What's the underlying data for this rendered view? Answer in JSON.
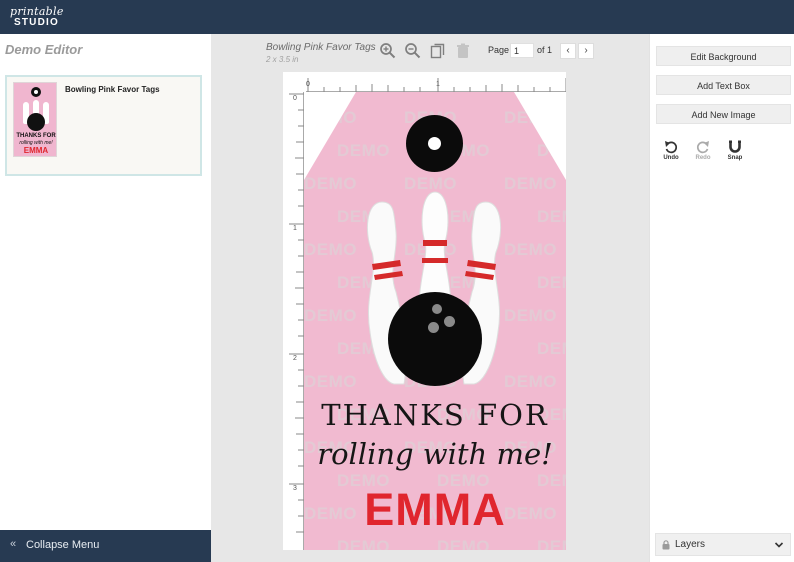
{
  "app": {
    "logo_line1": "printable",
    "logo_line2": "STUDIO"
  },
  "sidebar": {
    "title": "Demo Editor",
    "documents": [
      {
        "name": "Bowling Pink Favor Tags",
        "thumb_text_top": "THANKS FOR",
        "thumb_text_mid": "rolling with me!",
        "thumb_text_name": "EMMA"
      }
    ],
    "collapse_label": "Collapse Menu"
  },
  "toolbar": {
    "doc_title": "Bowling Pink Favor Tags",
    "doc_size": "2 x 3.5 in",
    "page_label": "Page",
    "page_value": "1",
    "page_of": "of 1",
    "prev_icon": "chevron-left-icon",
    "next_icon": "chevron-right-icon"
  },
  "rulers": {
    "top": [
      "0",
      "1"
    ],
    "left": [
      "0",
      "1",
      "2",
      "3"
    ]
  },
  "canvas": {
    "watermark": "DEMO",
    "line1": "THANKS FOR",
    "line2": "rolling with me!",
    "line3": "EMMA",
    "background_color": "#f1bad0",
    "name_color": "#e0262e"
  },
  "right_panel": {
    "buttons": [
      "Edit Background",
      "Add Text Box",
      "Add New Image"
    ],
    "actions": [
      {
        "label": "Undo",
        "icon": "undo-icon"
      },
      {
        "label": "Redo",
        "icon": "redo-icon"
      },
      {
        "label": "Snap",
        "icon": "magnet-icon"
      }
    ],
    "layers_label": "Layers"
  },
  "colors": {
    "topbar": "#273a52",
    "accent": "#cfe6e6"
  }
}
